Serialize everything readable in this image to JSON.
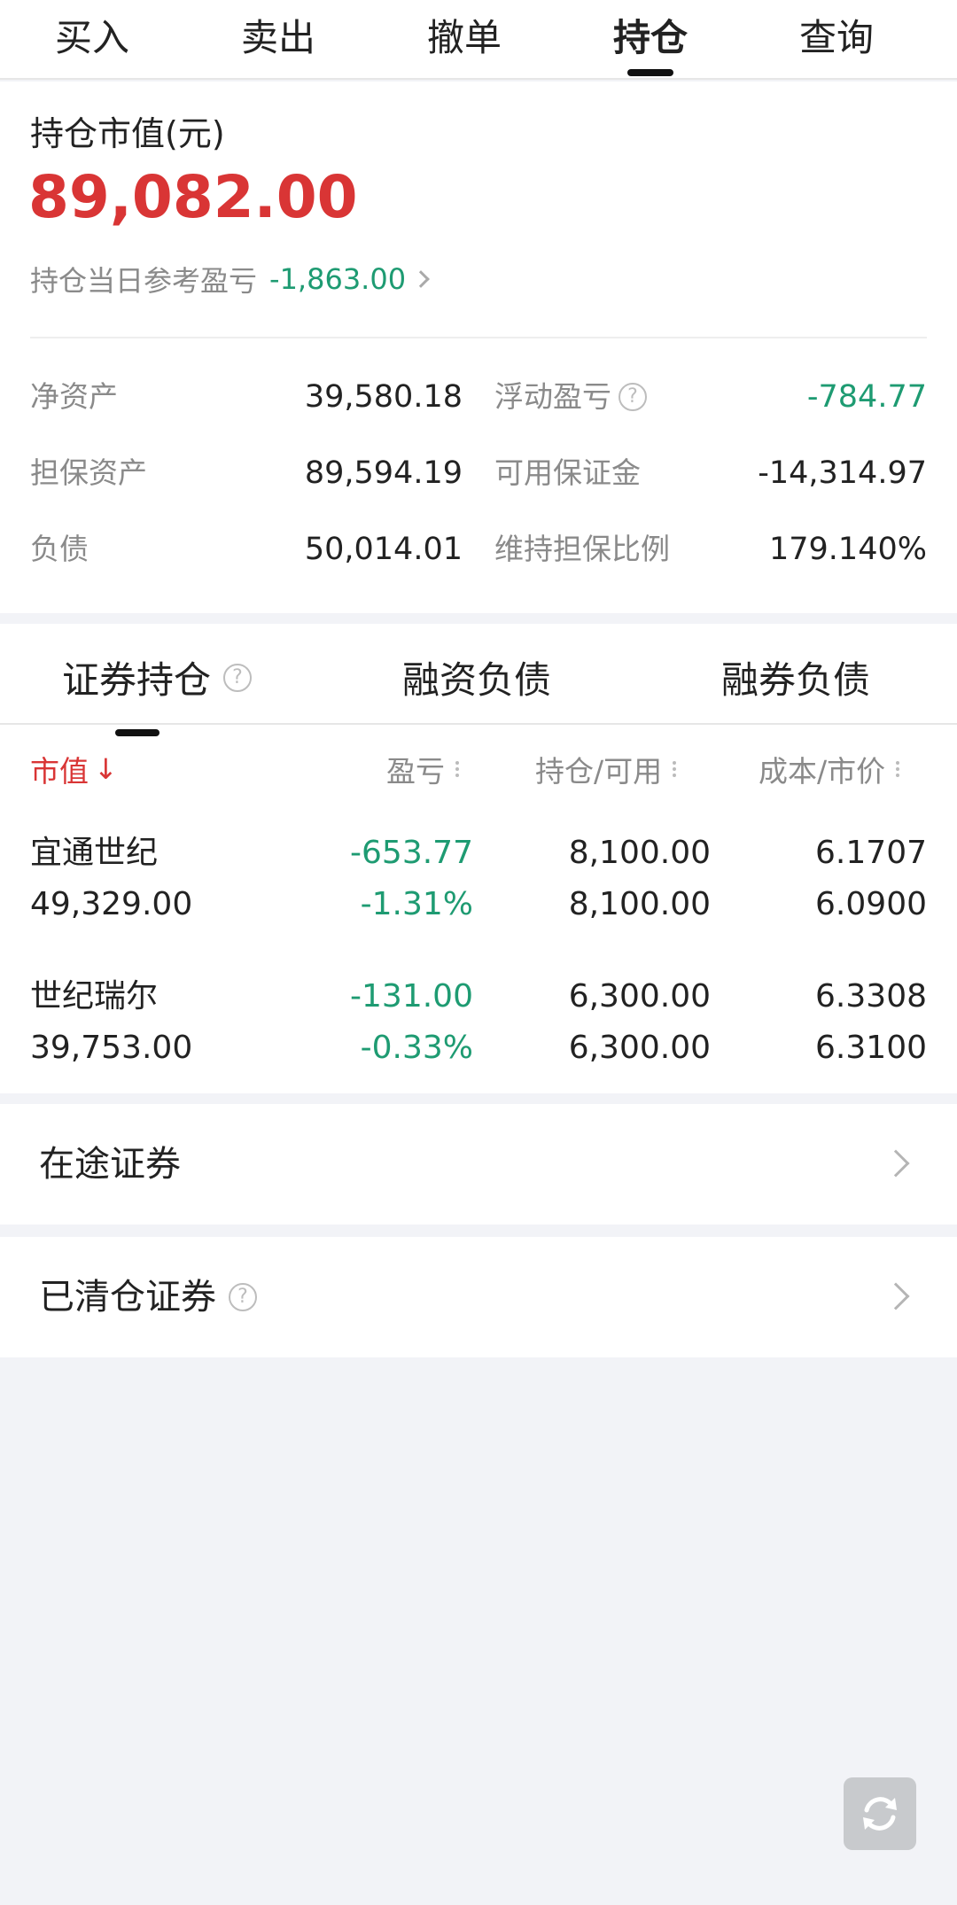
{
  "top_tabs": [
    "买入",
    "卖出",
    "撤单",
    "持仓",
    "查询"
  ],
  "top_tab_active_index": 3,
  "summary": {
    "title": "持仓市值(元)",
    "market_value": "89,082.00",
    "daily_pl_label": "持仓当日参考盈亏",
    "daily_pl_value": "-1,863.00",
    "rows": [
      {
        "k1": "净资产",
        "v1": "39,580.18",
        "k2": "浮动盈亏",
        "v2": "-784.77"
      },
      {
        "k1": "担保资产",
        "v1": "89,594.19",
        "k2": "可用保证金",
        "v2": "-14,314.97"
      },
      {
        "k1": "负债",
        "v1": "50,014.01",
        "k2": "维持担保比例",
        "v2": "179.140%"
      }
    ]
  },
  "sub_tabs": [
    "证券持仓",
    "融资负债",
    "融券负债"
  ],
  "columns": {
    "c1": "市值",
    "c2": "盈亏",
    "c3": "持仓/可用",
    "c4": "成本/市价"
  },
  "positions": [
    {
      "name": "宜通世纪",
      "market_value": "49,329.00",
      "pl": "-653.77",
      "pl_pct": "-1.31%",
      "hold": "8,100.00",
      "avail": "8,100.00",
      "cost": "6.1707",
      "price": "6.0900"
    },
    {
      "name": "世纪瑞尔",
      "market_value": "39,753.00",
      "pl": "-131.00",
      "pl_pct": "-0.33%",
      "hold": "6,300.00",
      "avail": "6,300.00",
      "cost": "6.3308",
      "price": "6.3100"
    }
  ],
  "links": {
    "in_transit": "在途证券",
    "cleared": "已清仓证券"
  },
  "colors": {
    "loss_green": "#1e9b72",
    "value_red": "#d93535",
    "background": "#f2f3f7"
  }
}
